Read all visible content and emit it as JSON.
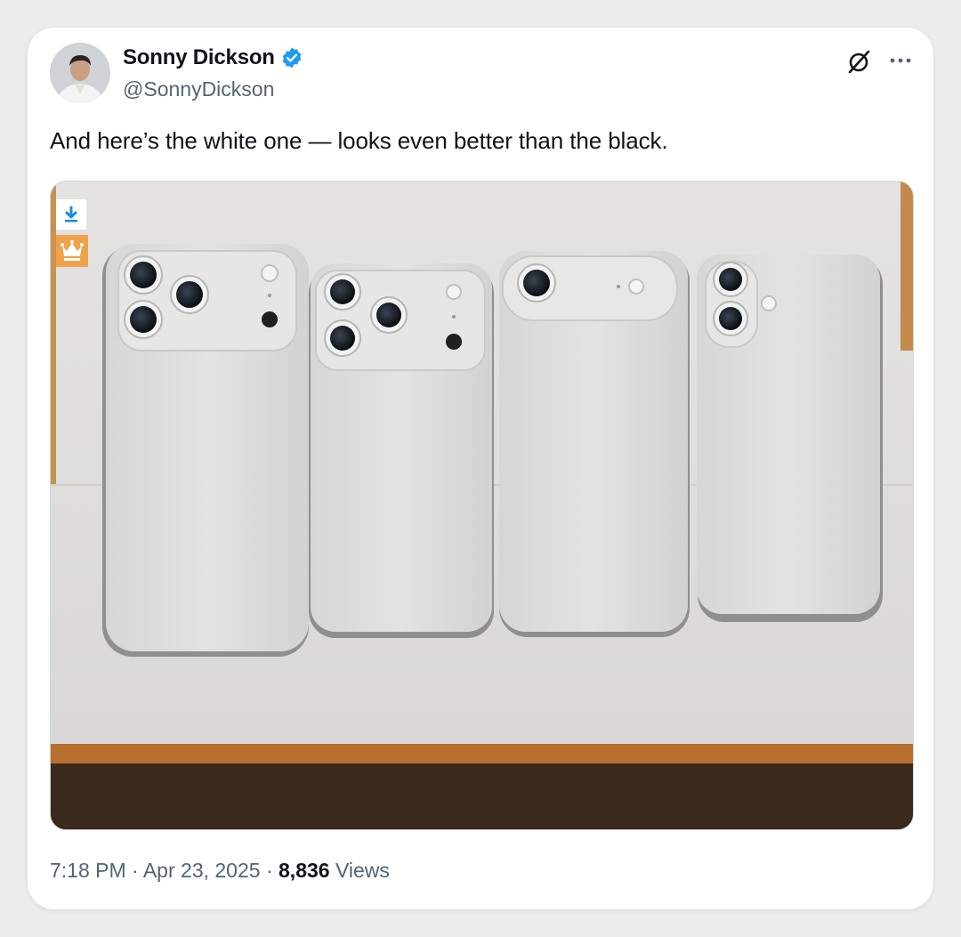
{
  "author": {
    "name": "Sonny Dickson",
    "handle": "@SonnyDickson",
    "verified_icon": "verified-badge-icon",
    "badge_color": "#1d9bf0"
  },
  "header_actions": {
    "grok_icon": "grok-slash-circle-icon",
    "more_icon": "more-horizontal-icon"
  },
  "tweet": {
    "text": "And here’s the white one — looks even better than the black."
  },
  "media": {
    "overlay_buttons": [
      "download-icon",
      "crown-vip-icon"
    ],
    "overlay_color": "#f0a24a"
  },
  "footer": {
    "time": "7:18 PM",
    "separator": "·",
    "date": "Apr 23, 2025",
    "views_count": "8,836",
    "views_label": "Views"
  }
}
